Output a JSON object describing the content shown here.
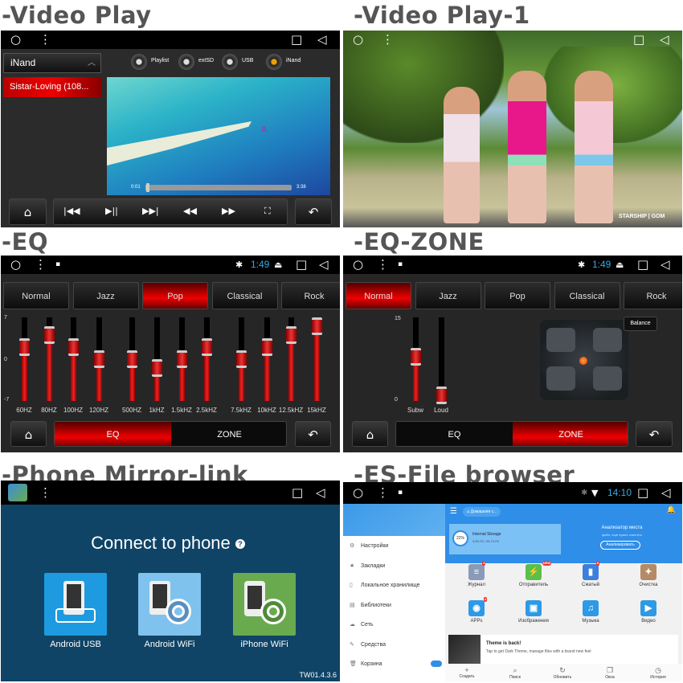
{
  "headings": [
    "-Video Play",
    "-Video Play-1",
    "-EQ",
    "-EQ-ZONE",
    "-Phone Mirror-link",
    "-ES-File browser"
  ],
  "status_icons": {
    "home": "circle-icon",
    "menu": "dots-icon",
    "recent": "square-icon",
    "back": "triangle-back-icon",
    "bluetooth": "bluetooth-icon",
    "eject": "eject-icon",
    "gallery": "image-icon",
    "wifi": "wifi-icon"
  },
  "video_play": {
    "source_dropdown": "iNand",
    "playlist": [
      "Sistar-Loving (108..."
    ],
    "sources": [
      {
        "label": "Playlist",
        "active": false
      },
      {
        "label": "extSD",
        "active": false
      },
      {
        "label": "USB",
        "active": false
      },
      {
        "label": "iNand",
        "active": true
      }
    ],
    "elapsed": "0:01",
    "duration": "3:38",
    "progress_fraction": 0.005,
    "controls": [
      "previous",
      "play-pause",
      "next",
      "rewind",
      "fast-forward",
      "fullscreen"
    ],
    "overlay_letter": "A"
  },
  "video_play_1": {
    "watermark": "STARSHIP | GOM"
  },
  "eq": {
    "time": "1:49",
    "presets": [
      "Normal",
      "Jazz",
      "Pop",
      "Classical",
      "Rock"
    ],
    "active_preset": "Pop",
    "y_ticks": [
      "7",
      "0",
      "-7"
    ],
    "range": [
      -7,
      7
    ],
    "bands": [
      {
        "label": "60HZ",
        "value": 2
      },
      {
        "label": "80HZ",
        "value": 4
      },
      {
        "label": "100HZ",
        "value": 2
      },
      {
        "label": "120HZ",
        "value": 0
      },
      {
        "label": "500HZ",
        "value": 0
      },
      {
        "label": "1kHZ",
        "value": -1.5
      },
      {
        "label": "1.5kHZ",
        "value": 0
      },
      {
        "label": "2.5kHZ",
        "value": 2
      },
      {
        "label": "7.5kHZ",
        "value": 0
      },
      {
        "label": "10kHZ",
        "value": 2
      },
      {
        "label": "12.5kHZ",
        "value": 4
      },
      {
        "label": "15kHZ",
        "value": 5.5
      }
    ],
    "tabs": [
      "EQ",
      "ZONE"
    ],
    "active_tab": "EQ"
  },
  "eq_zone": {
    "time": "1:49",
    "presets": [
      "Normal",
      "Jazz",
      "Pop",
      "Classical",
      "Rock"
    ],
    "active_preset": "Normal",
    "y_ticks": [
      "15",
      "0"
    ],
    "range": [
      0,
      15
    ],
    "sliders": [
      {
        "label": "Subw",
        "value": 8
      },
      {
        "label": "Loud",
        "value": 1
      }
    ],
    "balance_label": "Balance",
    "tabs": [
      "EQ",
      "ZONE"
    ],
    "active_tab": "ZONE"
  },
  "mirror_link": {
    "title": "Connect to phone",
    "help_icon": "?",
    "options": [
      {
        "label": "Android USB",
        "color": "#1e9be0"
      },
      {
        "label": "Android WiFi",
        "color": "#7fc2ee"
      },
      {
        "label": "iPhone WiFi",
        "color": "#6aaa4f"
      }
    ],
    "version": "TW01.4.3.6"
  },
  "es_file": {
    "time": "14:10",
    "breadcrumb": "Домашняя с...",
    "storage": {
      "name": "Internal Storage",
      "percent": "22%",
      "size": "3,69 ГБ / 26,74 ГБ"
    },
    "analyzer": {
      "title": "Анализатор места",
      "subtitle": "файл, ещё нужно очистить",
      "button": "Анализировать"
    },
    "drawer": [
      {
        "label": "Настройки",
        "icon": "gear-icon"
      },
      {
        "label": "Закладки",
        "icon": "star-icon"
      },
      {
        "label": "Локальное хранилище",
        "icon": "phone-icon"
      },
      {
        "label": "Библиотеки",
        "icon": "library-icon"
      },
      {
        "label": "Сеть",
        "icon": "network-icon"
      },
      {
        "label": "Средства",
        "icon": "wrench-icon"
      },
      {
        "label": "Корзина",
        "icon": "trash-icon",
        "toggle": true
      }
    ],
    "grid": [
      {
        "label": "Журнал",
        "color": "#8a9bb8",
        "badge": "3"
      },
      {
        "label": "Отправитель",
        "color": "#5bbf4a",
        "badge": "NEW"
      },
      {
        "label": "Сжатый",
        "color": "#3d7fdc",
        "badge": "6"
      },
      {
        "label": "Очистка",
        "color": "#b58a66",
        "badge": ""
      },
      {
        "label": "APPs",
        "color": "#2e9ae6",
        "badge": "4"
      },
      {
        "label": "Изображения",
        "color": "#2e9ae6",
        "badge": ""
      },
      {
        "label": "Музыка",
        "color": "#2e9ae6",
        "badge": ""
      },
      {
        "label": "Видео",
        "color": "#2e9ae6",
        "badge": ""
      }
    ],
    "theme_card": {
      "title": "Theme is back!",
      "text": "Tap to get Dark Theme, manage files with a brand new feel"
    },
    "bottom_nav": [
      {
        "label": "Создать",
        "icon": "+"
      },
      {
        "label": "Поиск",
        "icon": "⌕"
      },
      {
        "label": "Обновить",
        "icon": "↻"
      },
      {
        "label": "Окна",
        "icon": "❐"
      },
      {
        "label": "История",
        "icon": "◷"
      }
    ]
  }
}
